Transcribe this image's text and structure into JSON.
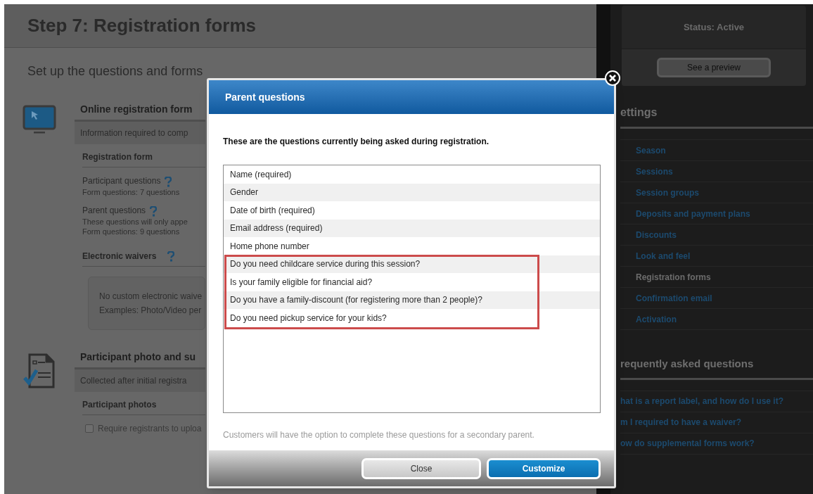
{
  "page": {
    "title": "Step 7: Registration forms",
    "intro": "Set up the questions and forms"
  },
  "sections": [
    {
      "kind": "online",
      "title": "Online registration form",
      "subtitle": "Information required to comp",
      "groups": [
        {
          "heading": "Registration form",
          "heading_help": false,
          "items": [
            {
              "label": "Participant questions",
              "help": true,
              "lines": [
                "Form questions: 7 questions"
              ]
            },
            {
              "label": "Parent questions",
              "help": true,
              "lines": [
                "These questions will only appe",
                "Form questions: 9 questions"
              ]
            }
          ]
        },
        {
          "heading": "Electronic waivers",
          "heading_help": true,
          "note": [
            "No custom electronic waive",
            "Examples: Photo/Video per"
          ]
        }
      ]
    },
    {
      "kind": "photo",
      "title": "Participant photo and su",
      "subtitle": "Collected after initial registra",
      "groups": [
        {
          "heading": "Participant photos",
          "heading_help": false,
          "checkbox": {
            "label": "Require registrants to uploa",
            "checked": false
          }
        }
      ]
    }
  ],
  "sidebar": {
    "status": "Status: Active",
    "preview_button": "See a preview",
    "settings_heading": "ettings",
    "settings": [
      {
        "label": "Season",
        "selected": false
      },
      {
        "label": "Sessions",
        "selected": false
      },
      {
        "label": "Session groups",
        "selected": false
      },
      {
        "label": "Deposits and payment plans",
        "selected": false
      },
      {
        "label": "Discounts",
        "selected": false
      },
      {
        "label": "Look and feel",
        "selected": false
      },
      {
        "label": "Registration forms",
        "selected": true
      },
      {
        "label": "Confirmation email",
        "selected": false
      },
      {
        "label": "Activation",
        "selected": false
      }
    ],
    "faq_heading": "requently asked questions",
    "faq": [
      "hat is a report label, and how do I use it?",
      "m I required to have a waiver?",
      "ow do supplemental forms work?"
    ]
  },
  "dialog": {
    "title": "Parent questions",
    "instruction": "These are the questions currently being asked during registration.",
    "questions": [
      {
        "text": "Name (required)",
        "highlighted": false
      },
      {
        "text": "Gender",
        "highlighted": false
      },
      {
        "text": "Date of birth (required)",
        "highlighted": false
      },
      {
        "text": "Email address (required)",
        "highlighted": false
      },
      {
        "text": "Home phone number",
        "highlighted": false
      },
      {
        "text": "Do you need childcare service during this session?",
        "highlighted": true
      },
      {
        "text": "Is your family eligible for financial aid?",
        "highlighted": true
      },
      {
        "text": "Do you have a family-discount (for registering more than 2 people)?",
        "highlighted": true
      },
      {
        "text": "Do you need pickup service for your kids?",
        "highlighted": true
      }
    ],
    "note": "Customers will have the option to complete these questions for a secondary parent.",
    "buttons": [
      {
        "label": "Close",
        "kind": "secondary"
      },
      {
        "label": "Customize",
        "kind": "primary"
      }
    ]
  }
}
